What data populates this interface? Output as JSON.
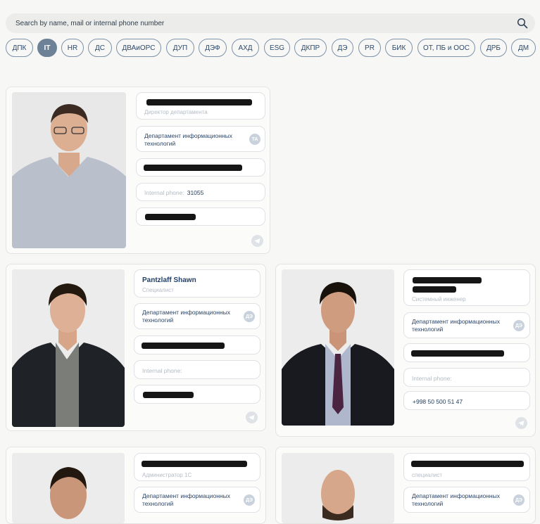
{
  "search": {
    "placeholder": "Search by name, mail or internal phone number",
    "value": ""
  },
  "filters": [
    {
      "label": "ДПК",
      "active": false
    },
    {
      "label": "IT",
      "active": true
    },
    {
      "label": "HR",
      "active": false
    },
    {
      "label": "ДС",
      "active": false
    },
    {
      "label": "ДВАиОРС",
      "active": false
    },
    {
      "label": "ДУП",
      "active": false
    },
    {
      "label": "ДЭФ",
      "active": false
    },
    {
      "label": "АХД",
      "active": false
    },
    {
      "label": "ESG",
      "active": false
    },
    {
      "label": "ДКПР",
      "active": false
    },
    {
      "label": "ДЭ",
      "active": false
    },
    {
      "label": "PR",
      "active": false
    },
    {
      "label": "БИК",
      "active": false
    },
    {
      "label": "ОТ, ПБ и ООС",
      "active": false
    },
    {
      "label": "ДРБ",
      "active": false
    },
    {
      "label": "ДМ",
      "active": false
    }
  ],
  "cards": [
    {
      "name": "",
      "position": "Директор департамента",
      "department": "Департамент информационных технологий",
      "badge": "ТА",
      "internal_phone_label": "Internal phone:",
      "internal_phone": "31055",
      "mobile": ""
    },
    {
      "name": "Pantzlaff Shawn",
      "position": "Специалист",
      "department": "Департамент информационных технологий",
      "badge": "ДЭ",
      "internal_phone_label": "Internal phone:",
      "internal_phone": "",
      "mobile": ""
    },
    {
      "name": "",
      "position": "Системный инженер",
      "department": "Департамент информационных технологий",
      "badge": "ДЭ",
      "internal_phone_label": "Internal phone:",
      "internal_phone": "",
      "mobile": "+998 50 500 51 47"
    },
    {
      "name": "",
      "position": "Администратор 1С",
      "department": "Департамент информационных технологий",
      "badge": "ДЭ"
    },
    {
      "name": "",
      "position": "специалист",
      "department": "Департамент информационных технологий",
      "badge": "ДЭ"
    }
  ],
  "colors": {
    "accent": "#6e8297",
    "chip_border": "#7f93aa",
    "text": "#1f3a5a",
    "muted": "#b6bdc5"
  }
}
